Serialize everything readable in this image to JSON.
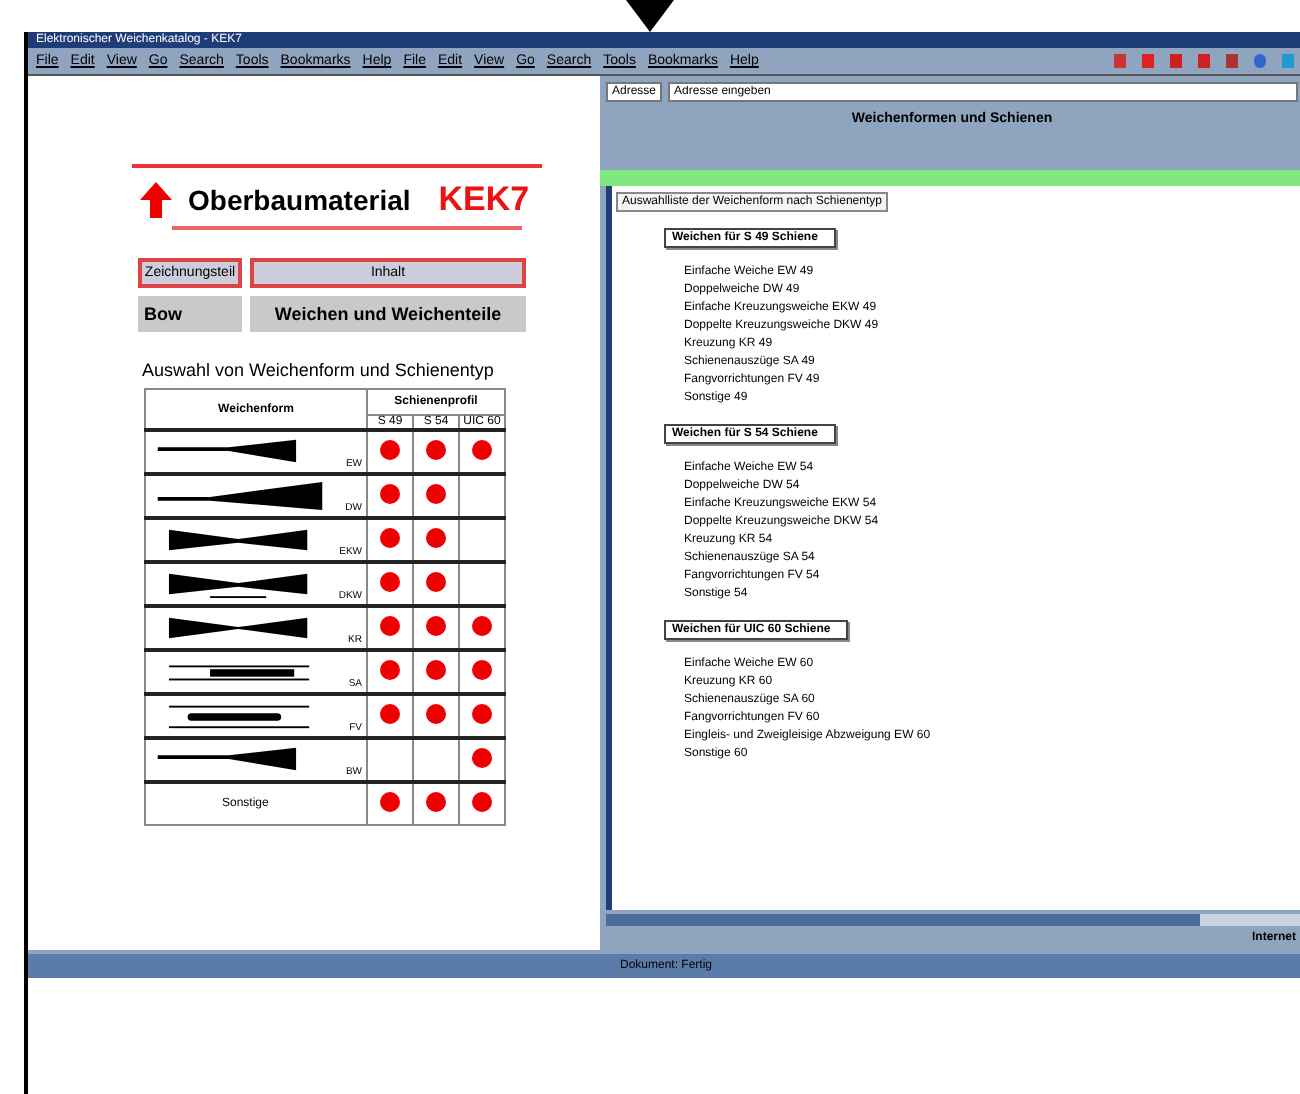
{
  "window": {
    "title": "Elektronischer Weichenkatalog - KEK7"
  },
  "menu_bar": {
    "menus": [
      "File",
      "Edit",
      "View",
      "Go",
      "Search",
      "Tools",
      "Bookmarks",
      "Help",
      "File",
      "Edit",
      "View",
      "Go",
      "Search",
      "Tools",
      "Bookmarks",
      "Help"
    ]
  },
  "left_frame": {
    "title": "Oberbaumaterial",
    "code": "KEK7",
    "nav": [
      {
        "label": "Zeichnungsteil",
        "selected": true
      },
      {
        "label": "Inhalt",
        "selected": true
      }
    ],
    "section": {
      "label": "Bow",
      "title": "Weichen und Weichenteile"
    },
    "heading": "Auswahl von Weichenform und Schienentyp",
    "table": {
      "columns": [
        "Weichenform",
        "Schienenprofil"
      ],
      "profiles": [
        "S 49",
        "S 54",
        "UIC 60"
      ],
      "rows": [
        {
          "kind": "single",
          "label": "EW",
          "available": [
            true,
            true,
            true
          ]
        },
        {
          "kind": "double",
          "label": "DW",
          "available": [
            true,
            true,
            false
          ]
        },
        {
          "kind": "crossing",
          "label": "EKW",
          "available": [
            true,
            true,
            false
          ]
        },
        {
          "kind": "crossing2",
          "label": "DKW",
          "available": [
            true,
            true,
            false
          ]
        },
        {
          "kind": "diamond",
          "label": "KR",
          "available": [
            true,
            true,
            true
          ]
        },
        {
          "kind": "expansion",
          "label": "SA",
          "available": [
            true,
            true,
            true
          ]
        },
        {
          "kind": "catch",
          "label": "FV",
          "available": [
            true,
            true,
            true
          ]
        },
        {
          "kind": "single",
          "label": "BW",
          "available": [
            false,
            false,
            true
          ]
        },
        {
          "kind": "text",
          "label": "Sonstige",
          "available": [
            true,
            true,
            true
          ]
        }
      ]
    }
  },
  "right_frame": {
    "address_label": "Adresse",
    "address_value": "Adresse eingeben",
    "title": "Weichenformen und Schienen",
    "tab": "Auswahlliste der Weichenform nach Schienentyp",
    "groups": [
      {
        "title": "Weichen für S 49 Schiene",
        "items": [
          "Einfache Weiche EW 49",
          "Doppelweiche DW 49",
          "Einfache Kreuzungsweiche EKW 49",
          "Doppelte Kreuzungsweiche DKW 49",
          "Kreuzung KR 49",
          "Schienenauszüge SA 49",
          "Fangvorrichtungen FV 49",
          "Sonstige 49"
        ]
      },
      {
        "title": "Weichen für S 54 Schiene",
        "items": [
          "Einfache Weiche EW 54",
          "Doppelweiche DW 54",
          "Einfache Kreuzungsweiche EKW 54",
          "Doppelte Kreuzungsweiche DKW 54",
          "Kreuzung KR 54",
          "Schienenauszüge SA 54",
          "Fangvorrichtungen FV 54",
          "Sonstige 54"
        ]
      },
      {
        "title": "Weichen für UIC 60 Schiene",
        "items": [
          "Einfache Weiche EW 60",
          "Kreuzung KR 60",
          "Schienenauszüge SA 60",
          "Fangvorrichtungen FV 60",
          "Eingleis- und Zweigleisige Abzweigung EW 60",
          "Sonstige 60"
        ]
      }
    ],
    "status": "Internet"
  },
  "status_bar": {
    "text": "Dokument: Fertig"
  }
}
